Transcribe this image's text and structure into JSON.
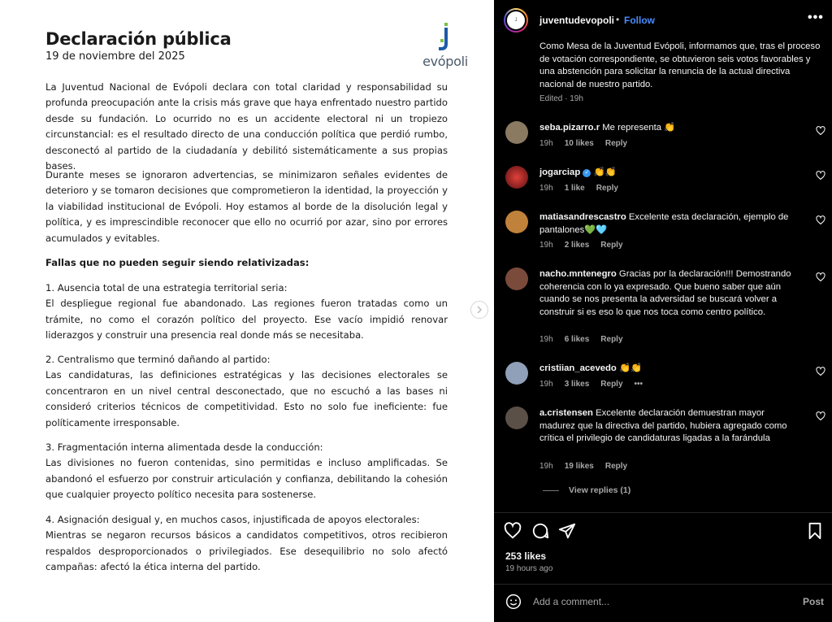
{
  "document": {
    "title": "Declaración pública",
    "date": "19 de noviembre del 2025",
    "logo_text": "evópoli",
    "p1": "La Juventud Nacional de Evópoli declara con total claridad y responsabilidad su profunda preocupación ante la crisis más grave que haya enfrentado nuestro partido desde su fundación. Lo ocurrido no es un accidente electoral ni un tropiezo circunstancial: es el resultado directo de una conducción política que perdió rumbo, desconectó al partido de la ciudadanía y debilitó sistemáticamente a sus propias bases.",
    "p2": "Durante meses se ignoraron advertencias, se minimizaron señales evidentes de deterioro y se tomaron decisiones que comprometieron la identidad, la proyección y la viabilidad institucional de Evópoli. Hoy estamos al borde de la disolución legal y política, y es imprescindible reconocer que ello no ocurrió por azar, sino por errores acumulados y evitables.",
    "p3": "Fallas que no pueden seguir siendo relativizadas:",
    "p4_head": " 1. Ausencia total de una estrategia territorial seria:",
    "p4": "El despliegue regional fue abandonado. Las regiones fueron tratadas como un trámite, no como el corazón político del proyecto. Ese vacío impidió renovar liderazgos y construir una presencia real donde más se necesitaba.",
    "p5_head": "2. Centralismo que terminó dañando al partido:",
    "p5": "Las candidaturas, las definiciones estratégicas y las decisiones electorales se concentraron en un nivel central desconectado, que no escuchó a las bases ni consideró criterios técnicos de competitividad. Esto no solo fue ineficiente: fue políticamente irresponsable.",
    "p6_head": " 3. Fragmentación interna alimentada desde la conducción:",
    "p6": "Las divisiones no fueron contenidas, sino permitidas e incluso amplificadas. Se abandonó el esfuerzo por construir articulación y confianza, debilitando la cohesión que cualquier proyecto político necesita para sostenerse.",
    "p7_head": " 4. Asignación desigual y, en muchos casos, injustificada de apoyos electorales:",
    "p7": "Mientras se negaron recursos básicos a candidatos competitivos, otros recibieron respaldos desproporcionados o privilegiados. Ese desequilibrio no solo afectó campañas: afectó la ética interna del partido."
  },
  "header": {
    "username": "juventudevopoli",
    "dot": "•",
    "follow": "Follow",
    "more": "•••"
  },
  "caption": {
    "text": "Como Mesa de la Juventud Evópoli, informamos que, tras el proceso de votación correspondiente, se obtuvieron seis votos favorables y una abstención para solicitar la renuncia de la actual directiva nacional de nuestro partido.",
    "edited": "Edited · 19h"
  },
  "comments": [
    {
      "user": "seba.pizarro.r",
      "text": "Me representa 👏",
      "time": "19h",
      "likes": "10 likes",
      "reply": "Reply",
      "avatar_color": "#8a7a62"
    },
    {
      "user": "jogarciap",
      "text": "👏👏",
      "time": "19h",
      "likes": "1 like",
      "reply": "Reply",
      "avatar_color": "#b3261e"
    },
    {
      "user": "matiasandrescastro",
      "text": "Excelente esta declaración, ejemplo de pantalones💚🩵",
      "time": "19h",
      "likes": "2 likes",
      "reply": "Reply",
      "avatar_color": "#c0823a"
    },
    {
      "user": "nacho.mntenegro",
      "text": "Gracias por la declaración!!! Demostrando coherencia con lo ya expresado. Que bueno saber que aún cuando se nos presenta la adversidad se buscará volver a construir si es eso lo que nos toca como centro político.",
      "time": "19h",
      "likes": "6 likes",
      "reply": "Reply",
      "avatar_color": "#7a4a3a"
    },
    {
      "user": "cristiian_acevedo",
      "text": "👏👏",
      "time": "19h",
      "likes": "3 likes",
      "reply": "Reply",
      "more": "•••",
      "avatar_color": "#8fa0b8"
    },
    {
      "user": "a.cristensen",
      "text": "Excelente declaración demuestran mayor madurez que la directiva del partido, hubiera agregado como crítica el privilegio de candidaturas ligadas a la farándula",
      "time": "19h",
      "likes": "19 likes",
      "reply": "Reply",
      "avatar_color": "#5a5048"
    }
  ],
  "view_replies": "View replies (1)",
  "likes": "253 likes",
  "posted": "19 hours ago",
  "add_comment_placeholder": "Add a comment...",
  "post_button": "Post",
  "icons": [
    "heart-icon",
    "comment-icon",
    "share-icon",
    "bookmark-icon",
    "emoji-icon",
    "chevron-right-icon"
  ],
  "colors": {
    "accent": "#4a8cff",
    "panel_bg": "#000000",
    "muted": "#a8a8a8",
    "logo_green": "#7ac143",
    "logo_blue": "#1e5aa8"
  }
}
